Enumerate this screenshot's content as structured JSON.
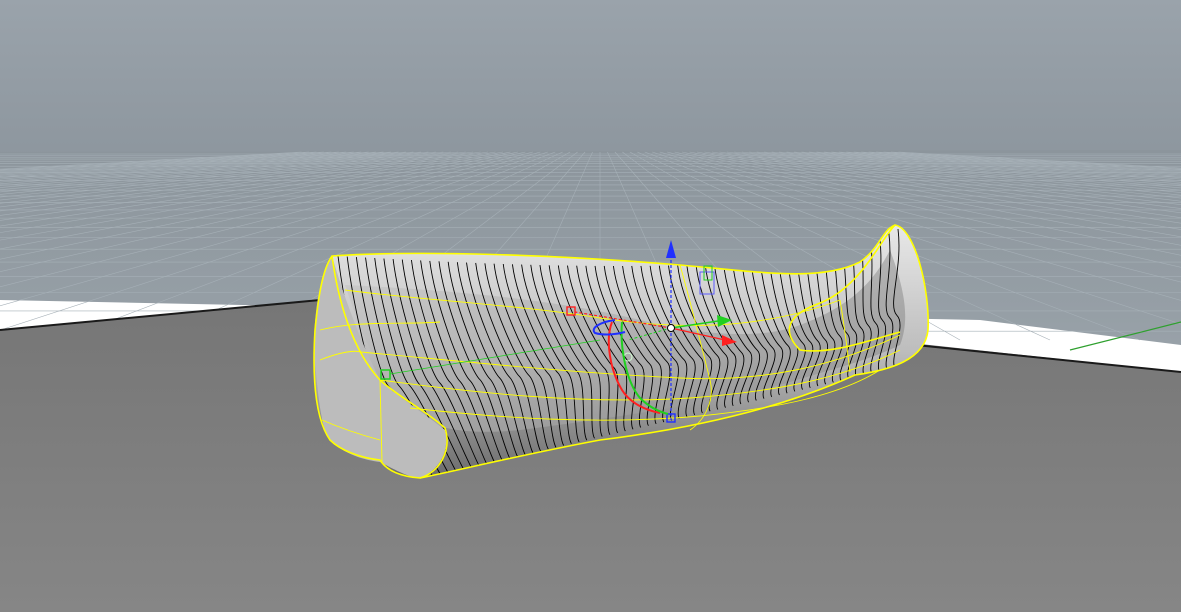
{
  "viewport": {
    "kind": "perspective-3d-modeling-viewport",
    "background_gradient": [
      "#9aa3ab",
      "#8c959d"
    ],
    "ground_color": "#7b7b7b",
    "grid_color": "#a9b3bb",
    "selection_highlight_color": "#ffff00",
    "isocurve_color": "#000000"
  },
  "gizmo": {
    "axis_colors": {
      "x": "#ff2020",
      "y": "#20d020",
      "z": "#2030ff"
    },
    "tools": [
      "translate-arrows",
      "rotate-arcs",
      "scale-handles"
    ]
  },
  "world_axes": {
    "x_color": "#5a0000",
    "y_color": "#2fa02f"
  }
}
